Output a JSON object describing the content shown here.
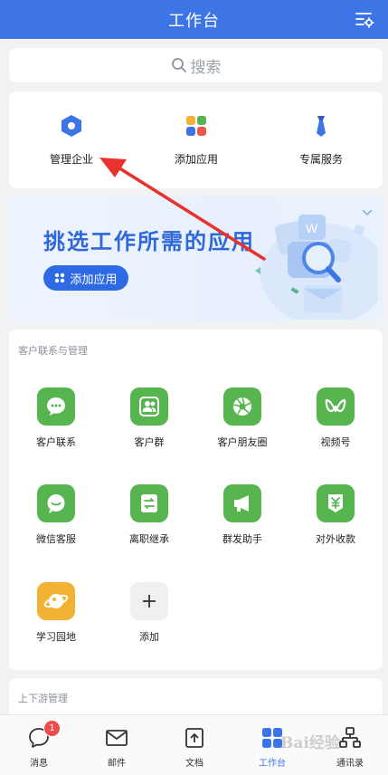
{
  "header": {
    "title": "工作台",
    "settings_icon": "list-settings-icon"
  },
  "search": {
    "placeholder": "搜索",
    "icon": "search-icon"
  },
  "quick_actions": [
    {
      "label": "管理企业",
      "icon": "hexagon-icon",
      "color": "#3d74e6"
    },
    {
      "label": "添加应用",
      "icon": "apps-grid-icon",
      "color": "#f2b233"
    },
    {
      "label": "专属服务",
      "icon": "tie-icon",
      "color": "#3d74e6"
    }
  ],
  "banner": {
    "title": "挑选工作所需的应用",
    "button_label": "添加应用",
    "collapse_icon": "chevron-down-icon",
    "art_badge": "W"
  },
  "customer_section": {
    "title": "客户联系与管理",
    "apps": [
      {
        "label": "客户联系",
        "icon": "chat-bubble-icon",
        "color": "#56b54f"
      },
      {
        "label": "客户群",
        "icon": "group-icon",
        "color": "#56b54f"
      },
      {
        "label": "客户朋友圈",
        "icon": "aperture-icon",
        "color": "#56b54f"
      },
      {
        "label": "视频号",
        "icon": "butterfly-icon",
        "color": "#56b54f"
      },
      {
        "label": "微信客服",
        "icon": "service-chat-icon",
        "color": "#56b54f"
      },
      {
        "label": "离职继承",
        "icon": "transfer-icon",
        "color": "#56b54f"
      },
      {
        "label": "群发助手",
        "icon": "megaphone-icon",
        "color": "#56b54f"
      },
      {
        "label": "对外收款",
        "icon": "yuan-icon",
        "color": "#56b54f"
      },
      {
        "label": "学习园地",
        "icon": "planet-icon",
        "color": "#f2b233"
      },
      {
        "label": "添加",
        "icon": "plus-icon",
        "color": "#f0f0f0"
      }
    ]
  },
  "upstream_section": {
    "title": "上下游管理"
  },
  "tabbar": {
    "tabs": [
      {
        "label": "消息",
        "icon": "message-icon",
        "badge": "1"
      },
      {
        "label": "邮件",
        "icon": "mail-icon"
      },
      {
        "label": "文档",
        "icon": "document-icon"
      },
      {
        "label": "工作台",
        "icon": "workbench-icon",
        "active": true
      },
      {
        "label": "通讯录",
        "icon": "contacts-icon"
      }
    ]
  },
  "watermark": "Bai经验",
  "colors": {
    "primary": "#3d74e6",
    "green": "#56b54f",
    "annotation_red": "#e8322e"
  }
}
